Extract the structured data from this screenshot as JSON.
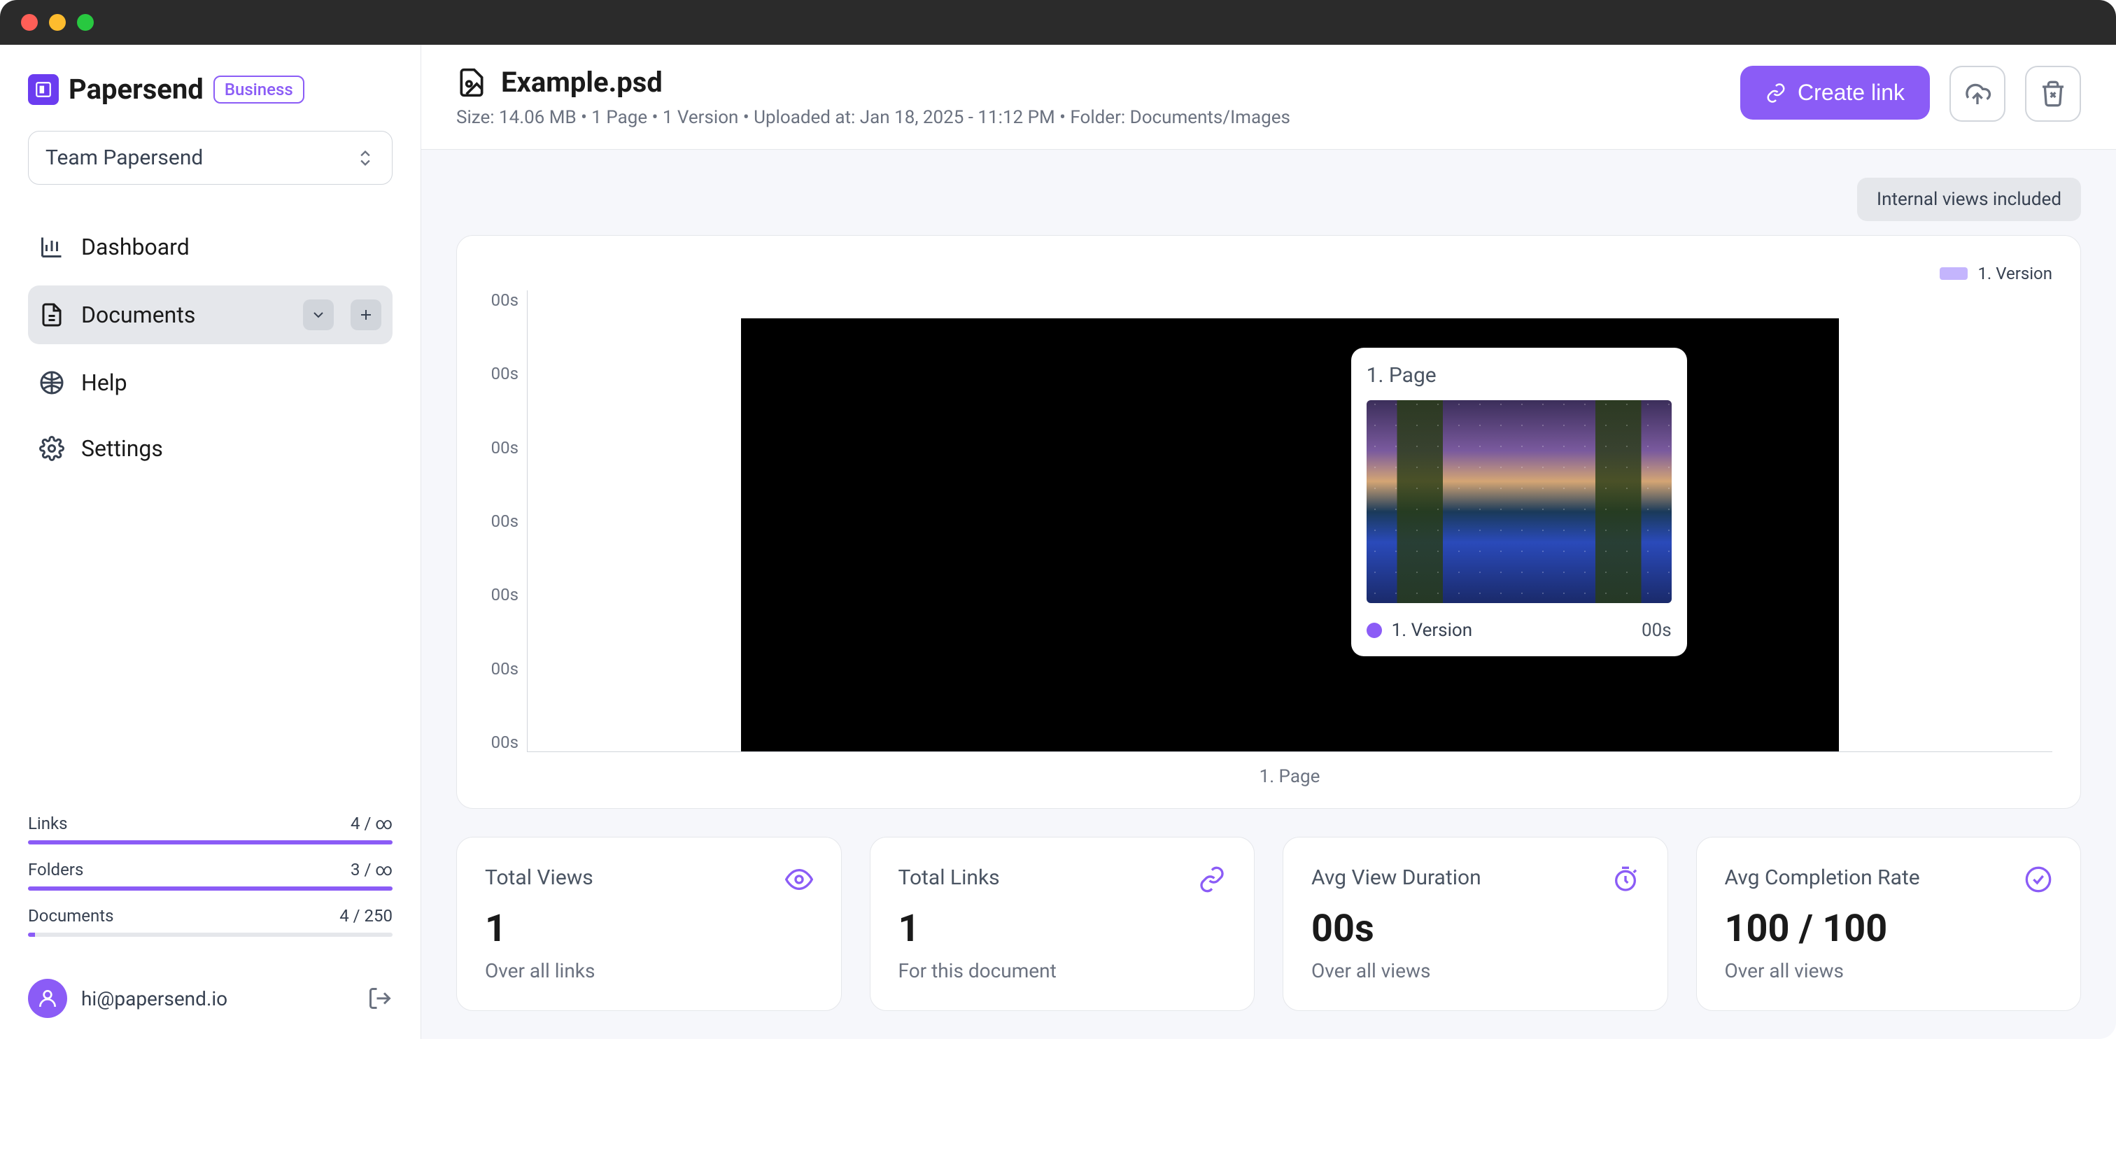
{
  "brand": {
    "name": "Papersend",
    "plan": "Business"
  },
  "team": {
    "selected": "Team Papersend"
  },
  "nav": {
    "dashboard": "Dashboard",
    "documents": "Documents",
    "help": "Help",
    "settings": "Settings"
  },
  "usage": {
    "links": {
      "label": "Links",
      "value": "4 / ∞",
      "fill_pct": 100
    },
    "folders": {
      "label": "Folders",
      "value": "3 / ∞",
      "fill_pct": 100
    },
    "documents": {
      "label": "Documents",
      "value": "4 / 250",
      "fill_pct": 2
    }
  },
  "user": {
    "email": "hi@papersend.io"
  },
  "document": {
    "title": "Example.psd",
    "meta": "Size: 14.06 MB • 1 Page • 1 Version • Uploaded at: Jan 18, 2025 - 11:12 PM • Folder: Documents/Images"
  },
  "actions": {
    "create_link": "Create link"
  },
  "filter": {
    "internal_views": "Internal views included"
  },
  "chart_data": {
    "type": "bar",
    "categories": [
      "1. Page"
    ],
    "series": [
      {
        "name": "1. Version",
        "values": [
          0
        ]
      }
    ],
    "y_unit": "s",
    "y_ticks": [
      "00s",
      "00s",
      "00s",
      "00s",
      "00s",
      "00s",
      "00s"
    ],
    "legend": "1. Version",
    "tooltip": {
      "title": "1. Page",
      "series_label": "1. Version",
      "value": "00s"
    }
  },
  "x_axis_label": "1. Page",
  "stats": {
    "views": {
      "label": "Total Views",
      "value": "1",
      "sub": "Over all links"
    },
    "links": {
      "label": "Total Links",
      "value": "1",
      "sub": "For this document"
    },
    "duration": {
      "label": "Avg View Duration",
      "value": "00s",
      "sub": "Over all views"
    },
    "completion": {
      "label": "Avg Completion Rate",
      "value": "100 / 100",
      "sub": "Over all views"
    }
  }
}
